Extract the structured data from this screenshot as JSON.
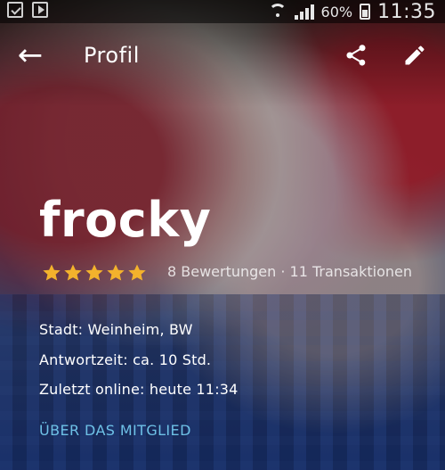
{
  "statusbar": {
    "battery_percent": "60%",
    "time": "11:35",
    "icons": [
      "notification-check-icon",
      "play-store-icon",
      "wifi-icon",
      "signal-icon",
      "battery-icon"
    ]
  },
  "appbar": {
    "title": "Profil",
    "icons": [
      "back-arrow-icon",
      "share-icon",
      "edit-icon"
    ]
  },
  "profile": {
    "username": "frocky",
    "rating": 5,
    "reviews_text": "8 Bewertungen · 11 Transaktionen",
    "city_text": "Stadt: Weinheim, BW",
    "response_time_text": "Antwortzeit:  ca. 10 Std.",
    "last_online_text": "Zuletzt online: heute 11:34",
    "about_link": "ÜBER DAS MITGLIED",
    "accent_color": "#6ec1e6",
    "star_color": "#f3b22c"
  }
}
